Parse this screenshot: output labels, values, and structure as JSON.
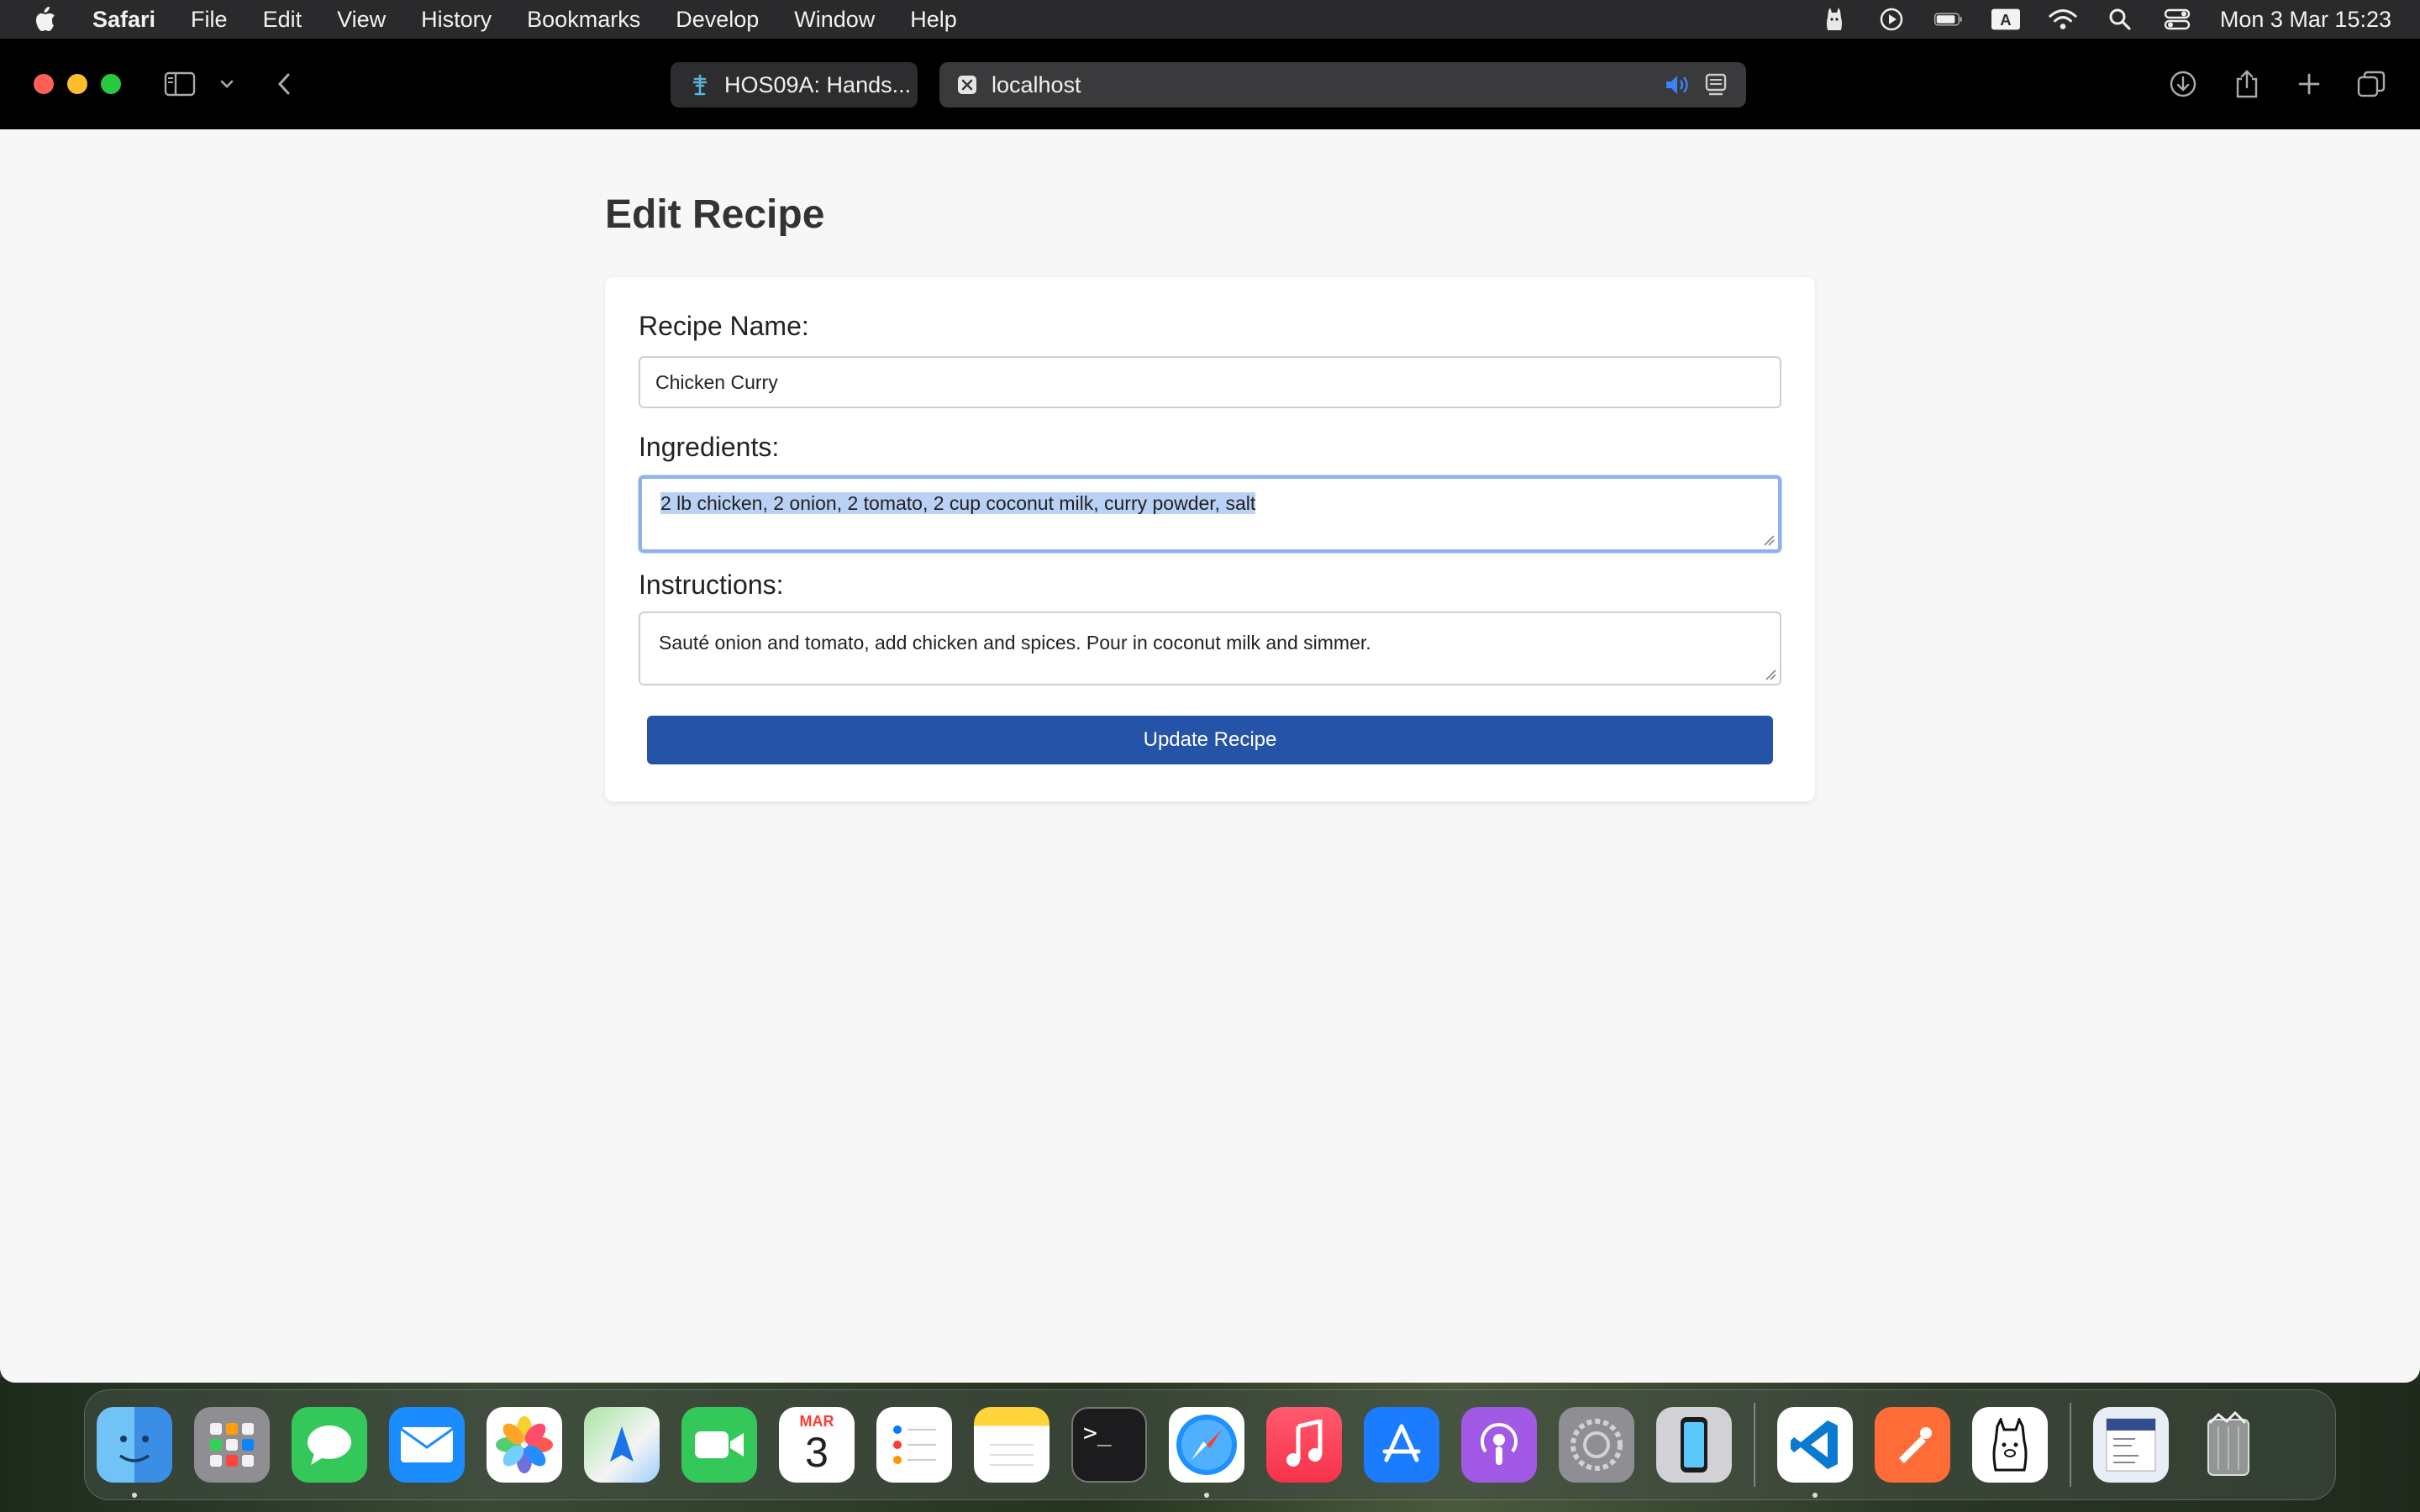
{
  "menubar": {
    "app_name": "Safari",
    "items": [
      "File",
      "Edit",
      "View",
      "History",
      "Bookmarks",
      "Develop",
      "Window",
      "Help"
    ],
    "clock": "Mon 3 Mar  15:23",
    "input_source": "A"
  },
  "browser": {
    "tabs": [
      {
        "label": "HOS09A: Hands..."
      },
      {
        "label": "localhost"
      }
    ]
  },
  "page": {
    "title": "Edit Recipe",
    "recipe_name_label": "Recipe Name:",
    "recipe_name_value": "Chicken Curry",
    "ingredients_label": "Ingredients:",
    "ingredients_value": "2 lb chicken, 2 onion, 2 tomato, 2 cup coconut milk, curry powder, salt",
    "instructions_label": "Instructions:",
    "instructions_value": "Sauté onion and tomato, add chicken and spices. Pour in coconut milk and simmer.",
    "submit_label": "Update Recipe"
  },
  "dock": {
    "calendar_month": "MAR",
    "calendar_day": "3",
    "terminal_prompt": ">_",
    "apps": [
      "finder",
      "launchpad",
      "messages",
      "mail",
      "photos",
      "maps",
      "facetime",
      "calendar",
      "reminders",
      "notes",
      "terminal",
      "safari",
      "music",
      "app-store",
      "podcasts",
      "system-settings",
      "iphone-mirroring",
      "vscode",
      "postman",
      "ollama",
      "document-preview",
      "trash"
    ]
  },
  "colors": {
    "accent_button": "#2453a8",
    "focus_ring": "#8fb2ef",
    "selection": "#b9d1f4"
  }
}
